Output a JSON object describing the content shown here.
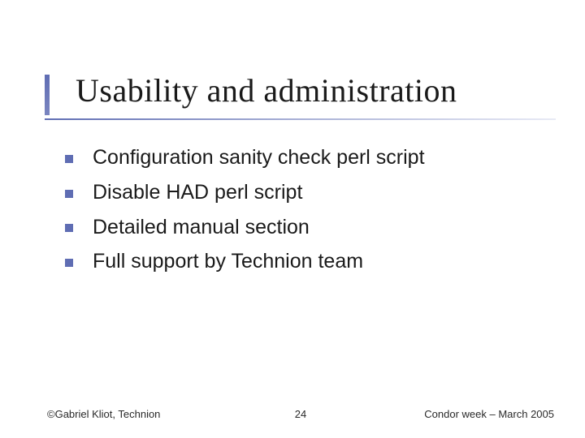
{
  "slide": {
    "title": "Usability and administration",
    "bullets": [
      "Configuration sanity check perl script",
      "Disable HAD perl script",
      "Detailed manual section",
      "Full support by Technion team"
    ]
  },
  "footer": {
    "left": "©Gabriel Kliot, Technion",
    "center": "24",
    "right": "Condor week – March 2005"
  }
}
